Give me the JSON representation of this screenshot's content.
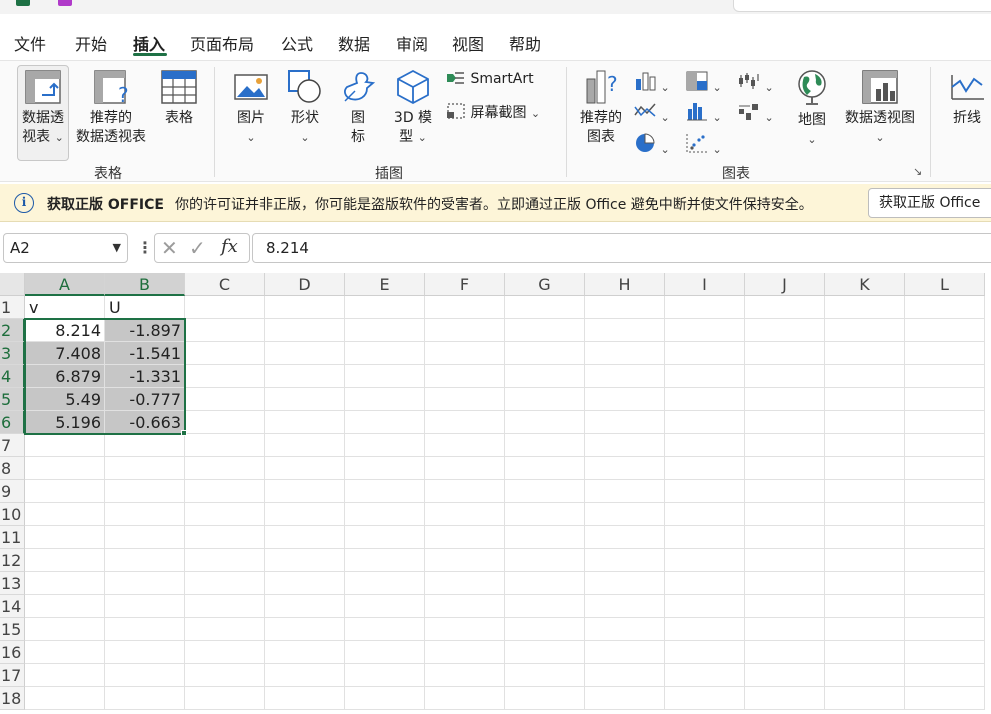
{
  "menu": {
    "tabs": [
      {
        "label": "文件"
      },
      {
        "label": "开始"
      },
      {
        "label": "插入"
      },
      {
        "label": "页面布局"
      },
      {
        "label": "公式"
      },
      {
        "label": "数据"
      },
      {
        "label": "审阅"
      },
      {
        "label": "视图"
      },
      {
        "label": "帮助"
      }
    ],
    "active_tab": "插入"
  },
  "ribbon": {
    "tables_group": {
      "label": "表格",
      "pivot_table": {
        "line1": "数据透",
        "line2": "视表"
      },
      "recommended_pivot": {
        "line1": "推荐的",
        "line2": "数据透视表"
      },
      "table": "表格"
    },
    "illustrations_group": {
      "label": "插图",
      "pictures": "图片",
      "shapes": "形状",
      "icons": {
        "line1": "图",
        "line2": "标"
      },
      "models_3d": {
        "line1": "3D 模",
        "line2": "型"
      },
      "smartart": "SmartArt",
      "screenshot": "屏幕截图"
    },
    "charts_group": {
      "label": "图表",
      "recommended_charts": {
        "line1": "推荐的",
        "line2": "图表"
      },
      "maps": "地图",
      "pivot_chart": "数据透视图"
    },
    "sparklines": {
      "line": "折线"
    }
  },
  "notice": {
    "title": "获取正版 OFFICE",
    "message": "你的许可证并非正版，你可能是盗版软件的受害者。立即通过正版 Office 避免中断并使文件保持安全。",
    "button": "获取正版 Office"
  },
  "formula_bar": {
    "name_box": "A2",
    "fx_label": "fx",
    "value": "8.214"
  },
  "sheet": {
    "columns": [
      "A",
      "B",
      "C",
      "D",
      "E",
      "F",
      "G",
      "H",
      "I",
      "J",
      "K",
      "L"
    ],
    "rows": [
      "1",
      "2",
      "3",
      "4",
      "5",
      "6",
      "7",
      "8",
      "9",
      "10",
      "11",
      "12",
      "13",
      "14",
      "15",
      "16",
      "17",
      "18"
    ],
    "header_row": [
      "v",
      "U"
    ],
    "data": [
      [
        "8.214",
        "-1.897"
      ],
      [
        "7.408",
        "-1.541"
      ],
      [
        "6.879",
        "-1.331"
      ],
      [
        "5.49",
        "-0.777"
      ],
      [
        "5.196",
        "-0.663"
      ]
    ],
    "selection": "A2:B6",
    "active_cell": "A2"
  }
}
